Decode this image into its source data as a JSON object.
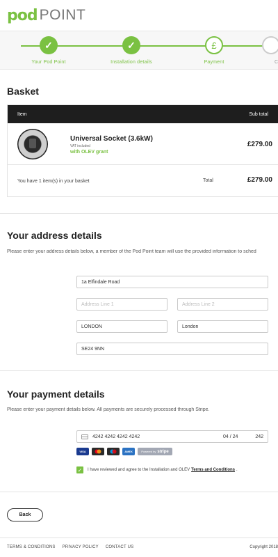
{
  "brand": {
    "pod": "pod",
    "point": "POINT",
    "accent": "#7ac142"
  },
  "steps": [
    {
      "label": "Your Pod Point",
      "state": "done",
      "icon": "check-icon"
    },
    {
      "label": "Installation details",
      "state": "done",
      "icon": "check-icon"
    },
    {
      "label": "Payment",
      "state": "current",
      "symbol": "£"
    },
    {
      "label": "C",
      "state": "pending"
    }
  ],
  "basket": {
    "title": "Basket",
    "col_item": "Item",
    "col_subtotal": "Sub total",
    "product": {
      "name": "Universal Socket (3.6kW)",
      "vat": "VAT included",
      "grant": "with OLEV grant",
      "price": "£279.00"
    },
    "summary": "You have 1 item(s) in your basket",
    "total_label": "Total",
    "total": "£279.00"
  },
  "address": {
    "title": "Your address details",
    "description": "Please enter your address details below, a member of the Pod Point team will use the provided information to sched",
    "line1": "1a Elfindale Road",
    "line1_ph": "Address Line 1",
    "line2_ph": "Address Line 2",
    "town": "LONDON",
    "county": "London",
    "postcode": "SE24 9NN"
  },
  "payment": {
    "title": "Your payment details",
    "description": "Please enter your payment details below. All payments are securely processed through Stripe.",
    "card_number": "4242 4242 4242 4242",
    "expiry": "04 / 24",
    "cvc": "242",
    "badges": [
      "VISA",
      "MC",
      "Maestro",
      "AMEX"
    ],
    "stripe_prefix": "Powered by",
    "stripe_word": "stripe",
    "agree_text": "I have reviewed and agree to the Installation and OLEV",
    "agree_link": "Terms and Conditions",
    "agree_end": ".",
    "agreed": true
  },
  "back_label": "Back",
  "footer": {
    "links": [
      "TERMS & CONDITIONS",
      "PRIVACY POLICY",
      "CONTACT US"
    ],
    "copyright": "Copyright 2018"
  }
}
